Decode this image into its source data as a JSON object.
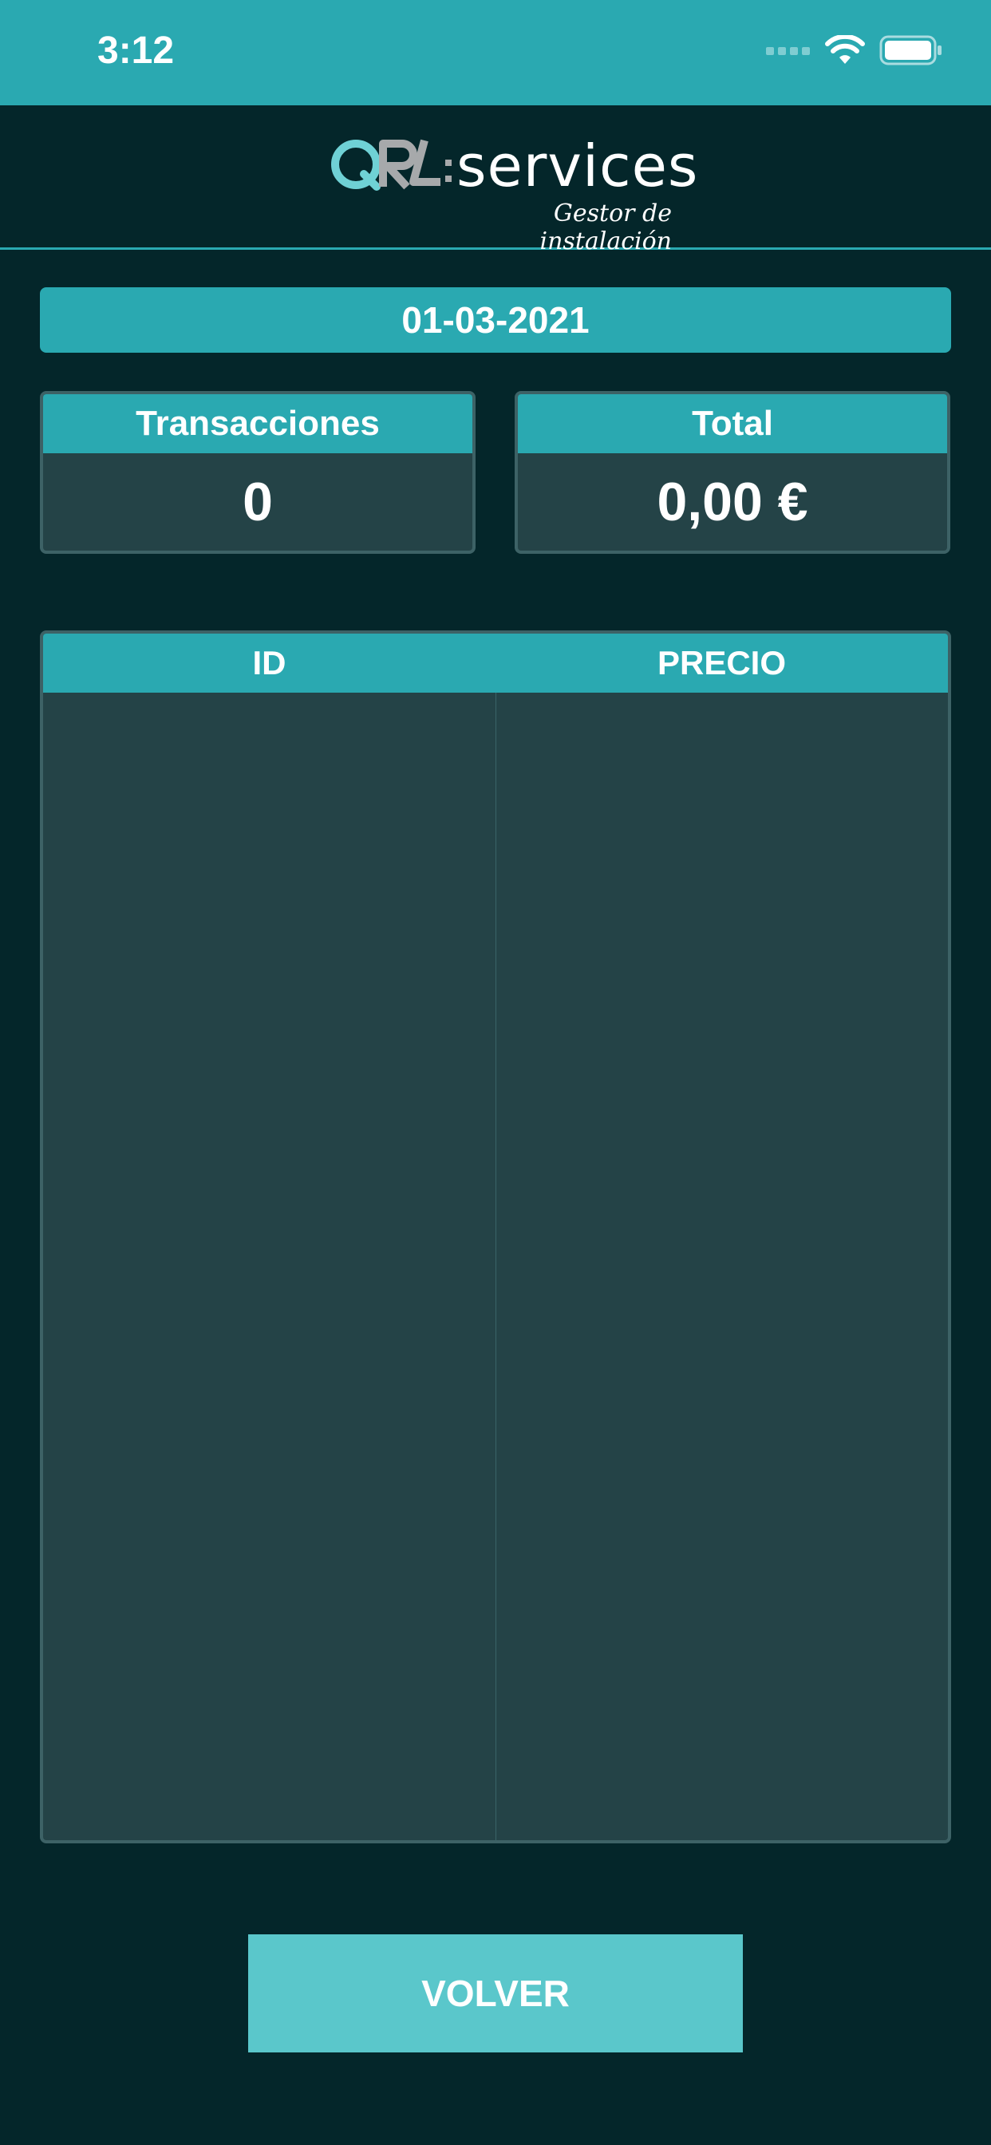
{
  "status_bar": {
    "time": "3:12",
    "icons": [
      "cellular-dots-icon",
      "wifi-icon",
      "battery-icon"
    ]
  },
  "header": {
    "logo_word": "services",
    "logo_tagline": "Gestor de instalación"
  },
  "date": "01-03-2021",
  "summary": {
    "transactions_label": "Transacciones",
    "transactions_value": "0",
    "total_label": "Total",
    "total_value": "0,00 €"
  },
  "table": {
    "columns": [
      "ID",
      "PRECIO"
    ],
    "rows": []
  },
  "actions": {
    "back_label": "VOLVER"
  },
  "colors": {
    "background": "#04262a",
    "accent": "#2aa9b1",
    "panel": "#244347",
    "button": "#5ac7cb"
  }
}
